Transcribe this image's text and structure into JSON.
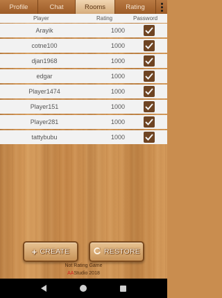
{
  "tabs": [
    {
      "label": "Profile",
      "active": false
    },
    {
      "label": "Chat",
      "active": false
    },
    {
      "label": "Rooms",
      "active": true
    },
    {
      "label": "Rating",
      "active": false
    }
  ],
  "table": {
    "headers": {
      "player": "Player",
      "rating": "Rating",
      "password": "Password"
    },
    "rows": [
      {
        "player": "Arayik",
        "rating": "1000",
        "password": true
      },
      {
        "player": "cotne100",
        "rating": "1000",
        "password": true
      },
      {
        "player": "djan1968",
        "rating": "1000",
        "password": true
      },
      {
        "player": "edgar",
        "rating": "1000",
        "password": true
      },
      {
        "player": "Player1474",
        "rating": "1000",
        "password": true
      },
      {
        "player": "Player151",
        "rating": "1000",
        "password": true
      },
      {
        "player": "Player281",
        "rating": "1000",
        "password": true
      },
      {
        "player": "tattybubu",
        "rating": "1000",
        "password": true
      }
    ]
  },
  "buttons": {
    "create_icon": "+",
    "create_label": "CREATE",
    "restore_label": "RESTORE"
  },
  "footer": {
    "mode": "Not Rating Game",
    "brand": "AA",
    "studio": "Studio 2018"
  },
  "colors": {
    "checkbox": "#6e4423",
    "brand_red": "#d21b1b",
    "active_tab": "#f1d6b2"
  }
}
